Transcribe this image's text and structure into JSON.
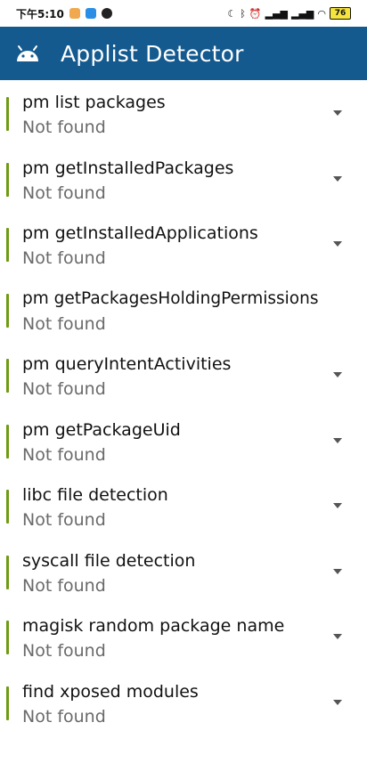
{
  "status_bar": {
    "time": "下午5:10",
    "battery": "76"
  },
  "app_bar": {
    "title": "Applist Detector",
    "icon": "android-icon"
  },
  "items": [
    {
      "title": "pm list packages",
      "status": "Not found"
    },
    {
      "title": "pm getInstalledPackages",
      "status": "Not found"
    },
    {
      "title": "pm getInstalledApplications",
      "status": "Not found"
    },
    {
      "title": "pm getPackagesHoldingPermissions",
      "status": "Not found"
    },
    {
      "title": "pm queryIntentActivities",
      "status": "Not found"
    },
    {
      "title": "pm getPackageUid",
      "status": "Not found"
    },
    {
      "title": "libc file detection",
      "status": "Not found"
    },
    {
      "title": "syscall file detection",
      "status": "Not found"
    },
    {
      "title": "magisk random package name",
      "status": "Not found"
    },
    {
      "title": "find xposed modules",
      "status": "Not found"
    }
  ],
  "colors": {
    "app_bar": "#145a8f",
    "indicator": "#6e9b12"
  }
}
